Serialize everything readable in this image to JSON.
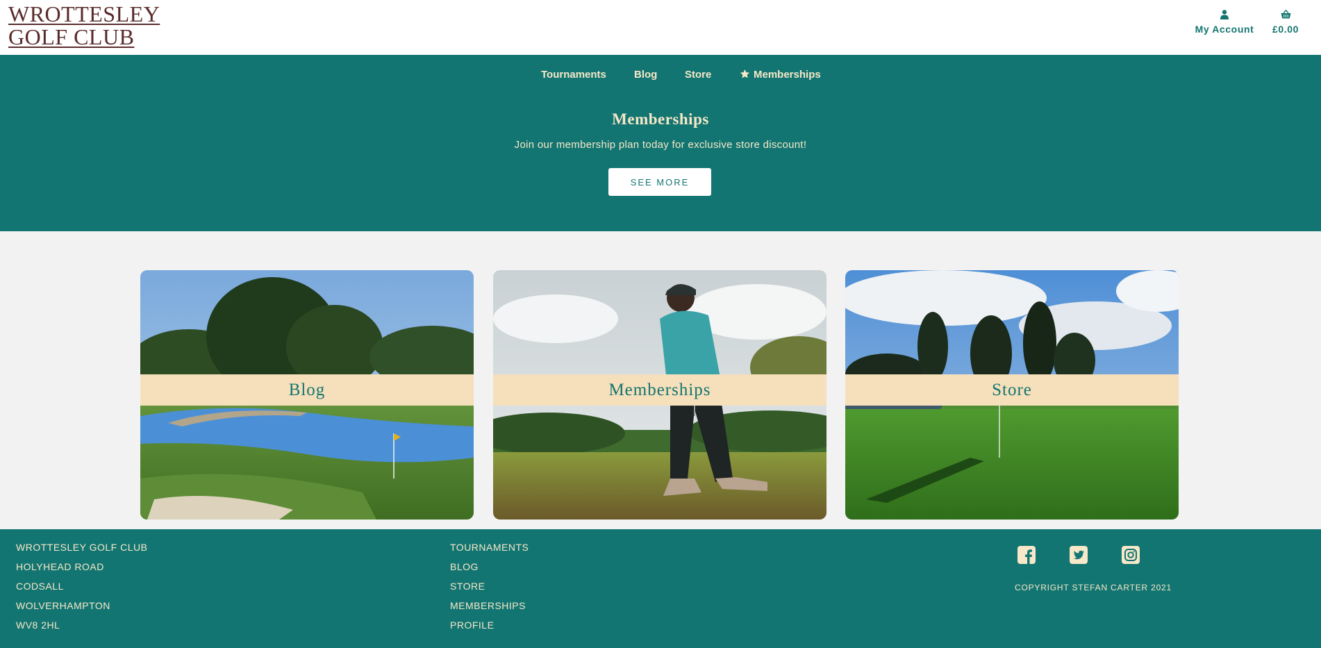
{
  "site": {
    "logo_line1": "WROTTESLEY",
    "logo_line2": "GOLF CLUB"
  },
  "header": {
    "account_label": "My Account",
    "cart_total": "£0.00",
    "account_icon": "user-icon",
    "cart_icon": "basket-icon"
  },
  "nav": {
    "items": [
      {
        "label": "Tournaments"
      },
      {
        "label": "Blog"
      },
      {
        "label": "Store"
      },
      {
        "label": "Memberships",
        "icon": "star-icon"
      }
    ]
  },
  "promo": {
    "title": "Memberships",
    "text": "Join our membership plan today for exclusive store discount!",
    "button_label": "SEE MORE"
  },
  "cards": [
    {
      "label": "Blog"
    },
    {
      "label": "Memberships"
    },
    {
      "label": "Store"
    }
  ],
  "footer": {
    "address": [
      "WROTTESLEY GOLF CLUB",
      "HOLYHEAD ROAD",
      "CODSALL",
      "WOLVERHAMPTON",
      "WV8 2HL"
    ],
    "links": [
      "TOURNAMENTS",
      "BLOG",
      "STORE",
      "MEMBERSHIPS",
      "PROFILE"
    ],
    "social": [
      "facebook-icon",
      "twitter-icon",
      "instagram-icon"
    ],
    "copyright": "COPYRIGHT STEFAN CARTER 2021"
  },
  "colors": {
    "brand_teal": "#137572",
    "cream": "#f6e8c8",
    "label_band": "#f6dfbb",
    "logo": "#5a2b2b"
  }
}
